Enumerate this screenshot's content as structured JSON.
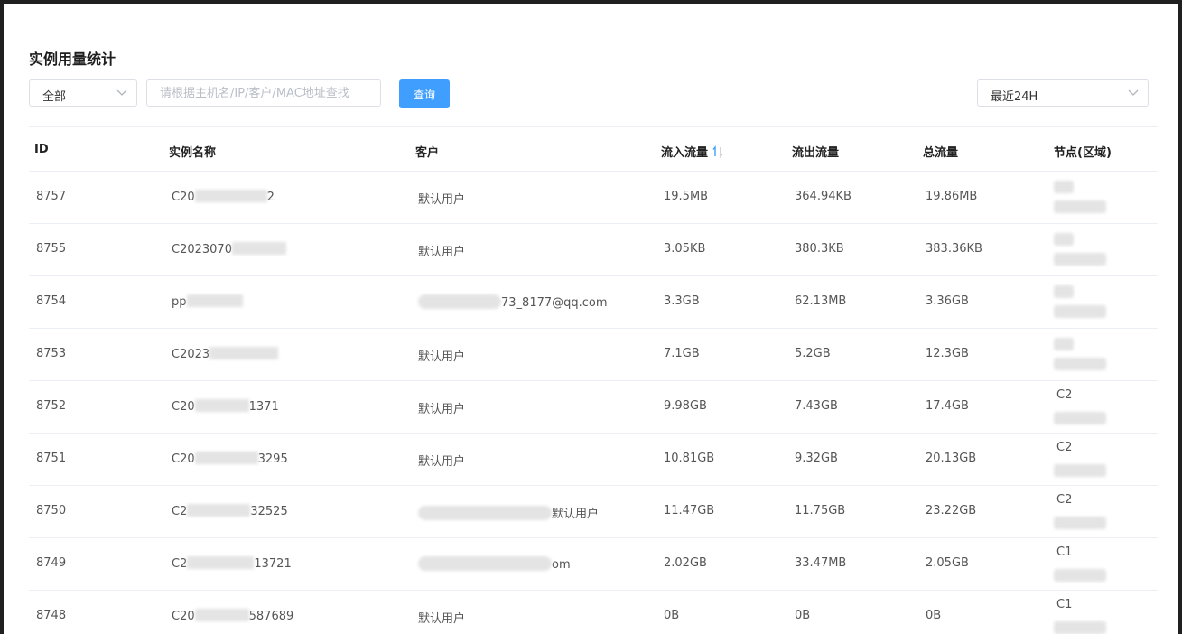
{
  "page": {
    "title": "实例用量统计"
  },
  "filters": {
    "scope_value": "全部",
    "search_placeholder": "请根据主机名/IP/客户/MAC地址查找",
    "search_value": "",
    "query_label": "查询",
    "time_range_value": "最近24H"
  },
  "table": {
    "columns": [
      "ID",
      "实例名称",
      "客户",
      "流入流量",
      "流出流量",
      "总流量",
      "节点(区域)"
    ],
    "sorted_column": "流入流量",
    "rows": [
      {
        "id": "8757",
        "name": "C20",
        "name_suffix": "2",
        "customer": "默认用户",
        "in": "19.5MB",
        "out": "364.94KB",
        "total": "19.86MB",
        "node": ""
      },
      {
        "id": "8755",
        "name": "C2023070",
        "name_suffix": "",
        "customer": "默认用户",
        "in": "3.05KB",
        "out": "380.3KB",
        "total": "383.36KB",
        "node": ""
      },
      {
        "id": "8754",
        "name": "pp",
        "name_suffix": "",
        "customer": "73_8177@qq.com",
        "in": "3.3GB",
        "out": "62.13MB",
        "total": "3.36GB",
        "node": ""
      },
      {
        "id": "8753",
        "name": "C2023",
        "name_suffix": "",
        "customer": "默认用户",
        "in": "7.1GB",
        "out": "5.2GB",
        "total": "12.3GB",
        "node": ""
      },
      {
        "id": "8752",
        "name": "C20",
        "name_suffix": "1371",
        "customer": "默认用户",
        "in": "9.98GB",
        "out": "7.43GB",
        "total": "17.4GB",
        "node": "C2"
      },
      {
        "id": "8751",
        "name": "C20",
        "name_suffix": "3295",
        "customer": "默认用户",
        "in": "10.81GB",
        "out": "9.32GB",
        "total": "20.13GB",
        "node": "C2"
      },
      {
        "id": "8750",
        "name": "C2",
        "name_suffix": "32525",
        "customer": "默认用户",
        "in": "11.47GB",
        "out": "11.75GB",
        "total": "23.22GB",
        "node": "C2"
      },
      {
        "id": "8749",
        "name": "C2",
        "name_suffix": "13721",
        "customer": "om",
        "in": "2.02GB",
        "out": "33.47MB",
        "total": "2.05GB",
        "node": "C1"
      },
      {
        "id": "8748",
        "name": "C20",
        "name_suffix": "587689",
        "customer": "默认用户",
        "in": "0B",
        "out": "0B",
        "total": "0B",
        "node": "C1"
      }
    ]
  },
  "colors": {
    "primary": "#409eff",
    "sort_icon": "#409eff",
    "border": "#ebeef5"
  }
}
